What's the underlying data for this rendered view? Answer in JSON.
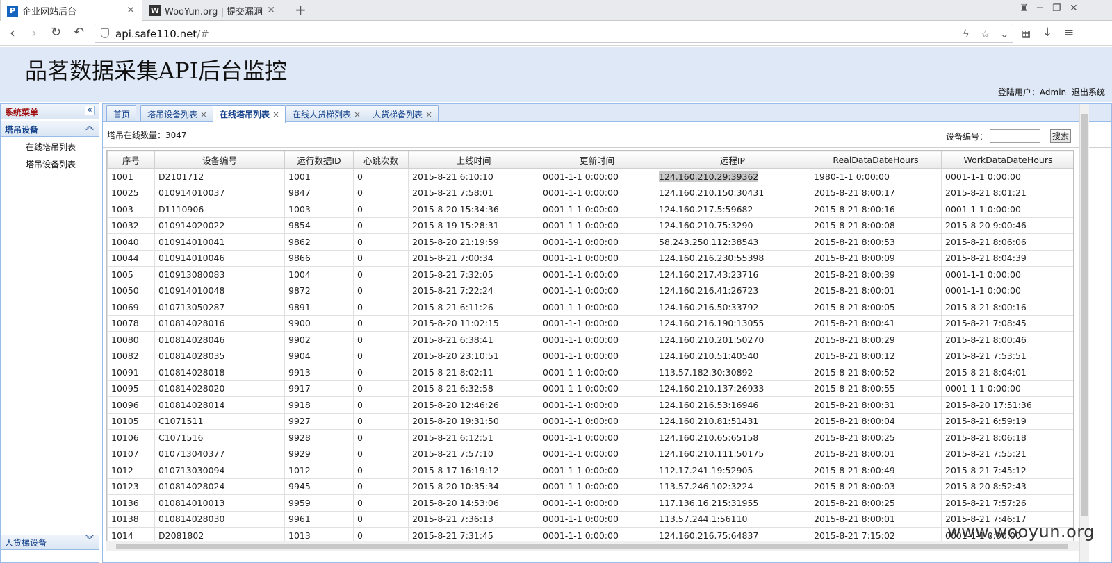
{
  "browser": {
    "tabs": [
      {
        "title": "企业网站后台",
        "active": true
      },
      {
        "title": "WooYun.org | 提交漏洞",
        "active": false
      }
    ],
    "url_host": "api.safe110.net",
    "url_rest": "/#"
  },
  "header": {
    "title": "品茗数据采集API后台监控",
    "login_label": "登陆用户：Admin",
    "logout_label": "退出系统"
  },
  "sidebar": {
    "menu_title": "系统菜单",
    "group1_title": "塔吊设备",
    "items": [
      "在线塔吊列表",
      "塔吊设备列表"
    ],
    "group2_title": "人货梯设备"
  },
  "tabs": [
    {
      "label": "首页",
      "closable": false
    },
    {
      "label": "塔吊设备列表",
      "closable": true
    },
    {
      "label": "在线塔吊列表",
      "closable": true,
      "active": true
    },
    {
      "label": "在线人货梯列表",
      "closable": true
    },
    {
      "label": "人货梯备列表",
      "closable": true
    }
  ],
  "toolbar": {
    "count_label": "塔吊在线数量：3047",
    "device_label": "设备编号：",
    "search_label": "搜索"
  },
  "table": {
    "columns": [
      "序号",
      "设备编号",
      "运行数据ID",
      "心跳次数",
      "上线时间",
      "更新时间",
      "远程IP",
      "RealDataDateHours",
      "WorkDataDateHours"
    ],
    "rows": [
      [
        "1001",
        "D2101712",
        "1001",
        "0",
        "2015-8-21 6:10:10",
        "0001-1-1 0:00:00",
        "124.160.210.29:39362",
        "1980-1-1 0:00:00",
        "0001-1-1 0:00:00"
      ],
      [
        "10025",
        "010914010037",
        "9847",
        "0",
        "2015-8-21 7:58:01",
        "0001-1-1 0:00:00",
        "124.160.210.150:30431",
        "2015-8-21 8:00:17",
        "2015-8-21 8:01:21"
      ],
      [
        "1003",
        "D1110906",
        "1003",
        "0",
        "2015-8-20 15:34:36",
        "0001-1-1 0:00:00",
        "124.160.217.5:59682",
        "2015-8-21 8:00:16",
        "0001-1-1 0:00:00"
      ],
      [
        "10032",
        "010914020022",
        "9854",
        "0",
        "2015-8-19 15:28:31",
        "0001-1-1 0:00:00",
        "124.160.210.75:3290",
        "2015-8-21 8:00:08",
        "2015-8-20 9:00:46"
      ],
      [
        "10040",
        "010914010041",
        "9862",
        "0",
        "2015-8-20 21:19:59",
        "0001-1-1 0:00:00",
        "58.243.250.112:38543",
        "2015-8-21 8:00:53",
        "2015-8-21 8:06:06"
      ],
      [
        "10044",
        "010914010046",
        "9866",
        "0",
        "2015-8-21 7:00:34",
        "0001-1-1 0:00:00",
        "124.160.216.230:55398",
        "2015-8-21 8:00:09",
        "2015-8-21 8:04:39"
      ],
      [
        "1005",
        "010913080083",
        "1004",
        "0",
        "2015-8-21 7:32:05",
        "0001-1-1 0:00:00",
        "124.160.217.43:23716",
        "2015-8-21 8:00:39",
        "0001-1-1 0:00:00"
      ],
      [
        "10050",
        "010914010048",
        "9872",
        "0",
        "2015-8-21 7:22:24",
        "0001-1-1 0:00:00",
        "124.160.216.41:26723",
        "2015-8-21 8:00:01",
        "0001-1-1 0:00:00"
      ],
      [
        "10069",
        "010713050287",
        "9891",
        "0",
        "2015-8-21 6:11:26",
        "0001-1-1 0:00:00",
        "124.160.216.50:33792",
        "2015-8-21 8:00:05",
        "2015-8-21 8:00:16"
      ],
      [
        "10078",
        "010814028016",
        "9900",
        "0",
        "2015-8-20 11:02:15",
        "0001-1-1 0:00:00",
        "124.160.216.190:13055",
        "2015-8-21 8:00:41",
        "2015-8-21 7:08:45"
      ],
      [
        "10080",
        "010814028046",
        "9902",
        "0",
        "2015-8-21 6:38:41",
        "0001-1-1 0:00:00",
        "124.160.210.201:50270",
        "2015-8-21 8:00:29",
        "2015-8-21 8:00:46"
      ],
      [
        "10082",
        "010814028035",
        "9904",
        "0",
        "2015-8-20 23:10:51",
        "0001-1-1 0:00:00",
        "124.160.210.51:40540",
        "2015-8-21 8:00:12",
        "2015-8-21 7:53:51"
      ],
      [
        "10091",
        "010814028018",
        "9913",
        "0",
        "2015-8-21 8:02:11",
        "0001-1-1 0:00:00",
        "113.57.182.30:30892",
        "2015-8-21 8:00:52",
        "2015-8-21 8:04:01"
      ],
      [
        "10095",
        "010814028020",
        "9917",
        "0",
        "2015-8-21 6:32:58",
        "0001-1-1 0:00:00",
        "124.160.210.137:26933",
        "2015-8-21 8:00:55",
        "0001-1-1 0:00:00"
      ],
      [
        "10096",
        "010814028014",
        "9918",
        "0",
        "2015-8-20 12:46:26",
        "0001-1-1 0:00:00",
        "124.160.216.53:16946",
        "2015-8-21 8:00:31",
        "2015-8-20 17:51:36"
      ],
      [
        "10105",
        "C1071511",
        "9927",
        "0",
        "2015-8-20 19:31:50",
        "0001-1-1 0:00:00",
        "124.160.210.81:51431",
        "2015-8-21 8:00:04",
        "2015-8-21 6:59:19"
      ],
      [
        "10106",
        "C1071516",
        "9928",
        "0",
        "2015-8-21 6:12:51",
        "0001-1-1 0:00:00",
        "124.160.210.65:65158",
        "2015-8-21 8:00:25",
        "2015-8-21 8:06:18"
      ],
      [
        "10107",
        "010713040377",
        "9929",
        "0",
        "2015-8-21 7:57:10",
        "0001-1-1 0:00:00",
        "124.160.210.111:50175",
        "2015-8-21 8:00:01",
        "2015-8-21 7:55:21"
      ],
      [
        "1012",
        "010713030094",
        "1012",
        "0",
        "2015-8-17 16:19:12",
        "0001-1-1 0:00:00",
        "112.17.241.19:52905",
        "2015-8-21 8:00:49",
        "2015-8-21 7:45:12"
      ],
      [
        "10123",
        "010814028024",
        "9945",
        "0",
        "2015-8-20 10:35:34",
        "0001-1-1 0:00:00",
        "113.57.246.102:3224",
        "2015-8-21 8:00:03",
        "2015-8-20 8:52:43"
      ],
      [
        "10136",
        "010814010013",
        "9959",
        "0",
        "2015-8-20 14:53:06",
        "0001-1-1 0:00:00",
        "117.136.16.215:31955",
        "2015-8-21 8:00:25",
        "2015-8-21 7:57:26"
      ],
      [
        "10138",
        "010814028030",
        "9961",
        "0",
        "2015-8-21 7:36:13",
        "0001-1-1 0:00:00",
        "113.57.244.1:56110",
        "2015-8-21 8:00:01",
        "2015-8-21 7:46:17"
      ],
      [
        "1014",
        "D2081802",
        "1013",
        "0",
        "2015-8-21 7:31:45",
        "0001-1-1 0:00:00",
        "124.160.216.75:64837",
        "2015-8-21 7:15:02",
        "0001-1-1 0:00:00"
      ]
    ]
  },
  "watermark": "www.wooyun.org",
  "colors": {
    "header_bg": "#dfe8f6",
    "accent": "#15428b",
    "menu_title": "#a01010"
  }
}
